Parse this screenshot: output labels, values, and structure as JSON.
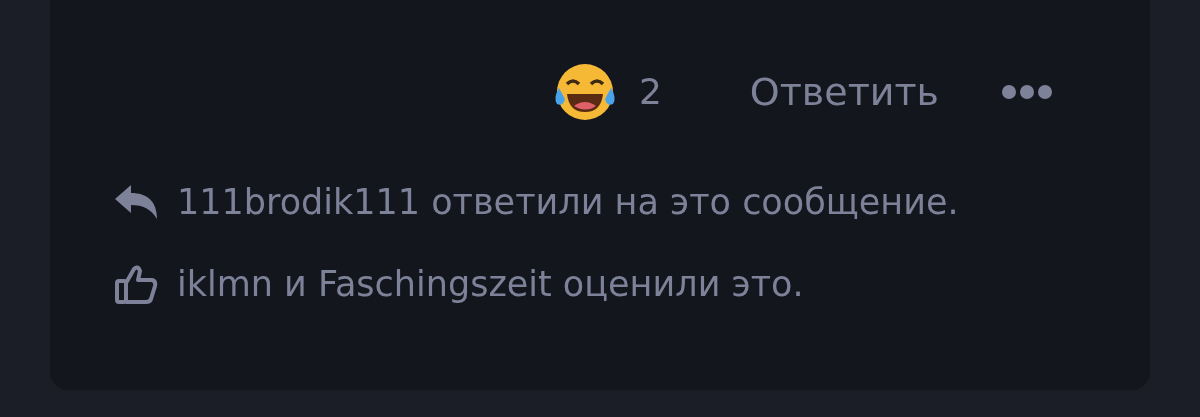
{
  "reaction": {
    "count": "2"
  },
  "reply_button": {
    "label": "Ответить"
  },
  "notices": [
    {
      "kind": "reply",
      "text": "111brodik111 ответили на это сообщение."
    },
    {
      "kind": "like",
      "text": "iklmn и Faschingszeit оценили это."
    }
  ]
}
